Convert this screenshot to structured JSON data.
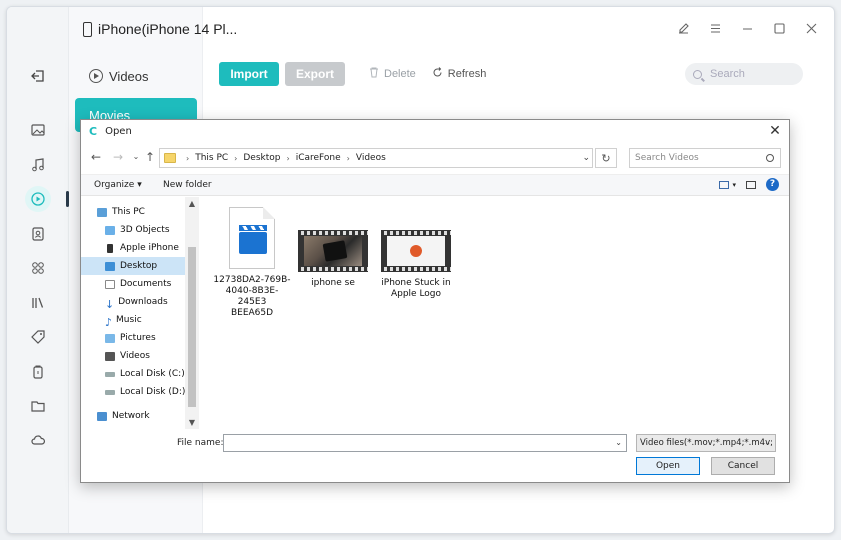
{
  "app": {
    "device_title": "iPhone(iPhone 14 Pl...",
    "subnav": {
      "videos_label": "Videos",
      "movies_label": "Movies"
    },
    "toolbar": {
      "import_label": "Import",
      "export_label": "Export",
      "delete_label": "Delete",
      "refresh_label": "Refresh"
    },
    "search": {
      "placeholder": "Search"
    },
    "rail_icons": [
      "back-icon",
      "photos-icon",
      "music-icon",
      "videos-icon",
      "contacts-icon",
      "apps-icon",
      "books-icon",
      "tag-icon",
      "backup-icon",
      "folder-icon",
      "cloud-icon"
    ]
  },
  "dialog": {
    "title": "Open",
    "breadcrumb": [
      "This PC",
      "Desktop",
      "iCareFone",
      "Videos"
    ],
    "search_placeholder": "Search Videos",
    "organize_label": "Organize",
    "new_folder_label": "New folder",
    "nav_tree": [
      {
        "label": "This PC",
        "icon": "pc-icon"
      },
      {
        "label": "3D Objects",
        "icon": "cube-icon"
      },
      {
        "label": "Apple iPhone",
        "icon": "iphone-icon"
      },
      {
        "label": "Desktop",
        "icon": "desktop-icon",
        "selected": true
      },
      {
        "label": "Documents",
        "icon": "documents-icon"
      },
      {
        "label": "Downloads",
        "icon": "downloads-icon"
      },
      {
        "label": "Music",
        "icon": "music-note-icon"
      },
      {
        "label": "Pictures",
        "icon": "pictures-icon"
      },
      {
        "label": "Videos",
        "icon": "videos-icon"
      },
      {
        "label": "Local Disk (C:)",
        "icon": "disk-icon"
      },
      {
        "label": "Local Disk (D:)",
        "icon": "disk-icon"
      },
      {
        "label": "Network",
        "icon": "network-icon"
      }
    ],
    "files": [
      {
        "name_line1": "12738DA2-769B-",
        "name_line2": "4040-8B3E-245E3",
        "name_line3": "BEEA65D",
        "type": "video-document"
      },
      {
        "name_line1": "iphone se",
        "type": "video-thumbnail"
      },
      {
        "name_line1": "iPhone Stuck in",
        "name_line2": "Apple Logo",
        "type": "video-thumbnail"
      }
    ],
    "file_name_label": "File name:",
    "file_name_value": "",
    "filter_value": "Video files(*.mov;*.mp4;*.m4v;",
    "open_label": "Open",
    "cancel_label": "Cancel"
  },
  "colors": {
    "accent": "#1ebcbd",
    "disabled": "#c7cacd",
    "selection": "#cce4f7"
  }
}
